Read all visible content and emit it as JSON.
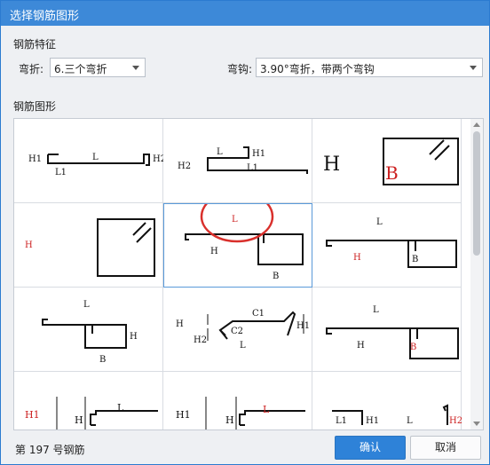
{
  "window": {
    "title": "选择钢筋图形"
  },
  "features": {
    "section_label": "钢筋特征",
    "bend_label": "弯折:",
    "bend_value": "6.三个弯折",
    "hook_label": "弯钩:",
    "hook_value": "3.90°弯折，带两个弯钩"
  },
  "shapes": {
    "section_label": "钢筋图形",
    "selected_index": 4,
    "cells": [
      {
        "labels": [
          "H1",
          "L1",
          "L",
          "H2"
        ]
      },
      {
        "labels": [
          "L",
          "H1",
          "H2",
          "L1"
        ]
      },
      {
        "labels": [
          "H",
          "B"
        ]
      },
      {
        "labels": [
          "H"
        ]
      },
      {
        "labels": [
          "L",
          "H",
          "B"
        ]
      },
      {
        "labels": [
          "L",
          "H",
          "B"
        ]
      },
      {
        "labels": [
          "L",
          "H",
          "B"
        ]
      },
      {
        "labels": [
          "H",
          "C1",
          "H2",
          "C2",
          "H1",
          "L"
        ]
      },
      {
        "labels": [
          "L",
          "H",
          "B"
        ]
      },
      {
        "labels": [
          "H1",
          "H",
          "L"
        ]
      },
      {
        "labels": [
          "H1",
          "H",
          "L"
        ]
      },
      {
        "labels": [
          "L1",
          "H1",
          "L",
          "H2"
        ]
      }
    ]
  },
  "status": {
    "text": "第 197 号钢筋"
  },
  "buttons": {
    "ok": "确认",
    "cancel": "取消"
  },
  "colors": {
    "accent": "#3d89d8",
    "highlight": "#d9302c",
    "label_red": "#cc1f1f"
  }
}
